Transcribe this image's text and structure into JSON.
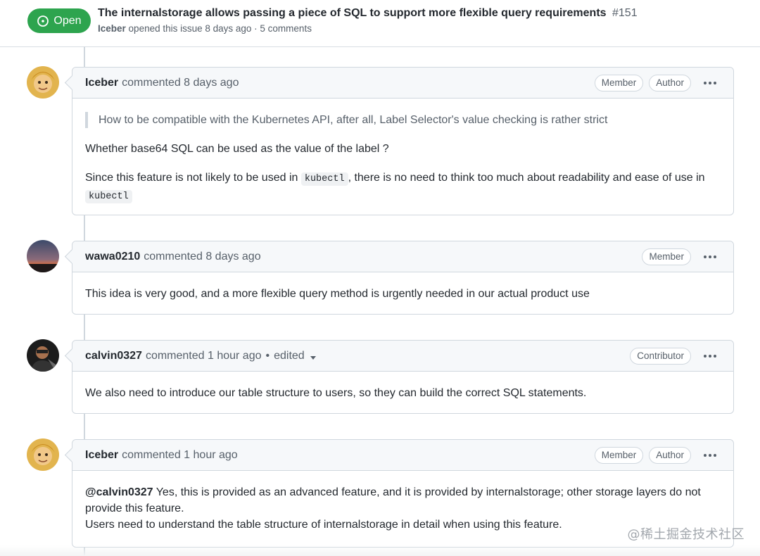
{
  "issue": {
    "state": "Open",
    "title": "The internalstorage allows passing a piece of SQL to support more flexible query requirements",
    "number": "#151",
    "author": "Iceber",
    "meta_rest": "opened this issue 8 days ago · 5 comments"
  },
  "comments": [
    {
      "user": "Iceber",
      "action": "commented 8 days ago",
      "labels": [
        "Member",
        "Author"
      ],
      "quote": "How to be compatible with the Kubernetes API, after all, Label Selector's value checking is rather strict",
      "paragraph1": "Whether base64 SQL can be used as the value of the label ?",
      "p2_before": "Since this feature is not likely to be used in ",
      "code": "kubectl",
      "p2_after": ", there is no need to think too much about readability and ease of use in "
    },
    {
      "user": "wawa0210",
      "action": "commented 8 days ago",
      "labels": [
        "Member"
      ],
      "body": "This idea is very good, and a more flexible query method is urgently needed in our actual product use"
    },
    {
      "user": "calvin0327",
      "action": "commented 1 hour ago",
      "dot": "•",
      "edited": "edited",
      "labels": [
        "Contributor"
      ],
      "body": "We also need to introduce our table structure to users, so they can build the correct SQL statements."
    },
    {
      "user": "Iceber",
      "action": "commented 1 hour ago",
      "labels": [
        "Member",
        "Author"
      ],
      "mention": "@calvin0327",
      "line1": " Yes, this is provided as an advanced feature, and it is provided by internalstorage; other storage layers do not provide this feature.",
      "line2": "Users need to understand the table structure of internalstorage in detail when using this feature."
    }
  ],
  "watermark": "@稀土掘金技术社区",
  "colors": {
    "open_green": "#2da44e",
    "border": "#d0d7de",
    "header_bg": "#f6f8fa"
  },
  "icons": [
    "issue-opened-icon",
    "kebab-icon",
    "caret-down-icon"
  ]
}
